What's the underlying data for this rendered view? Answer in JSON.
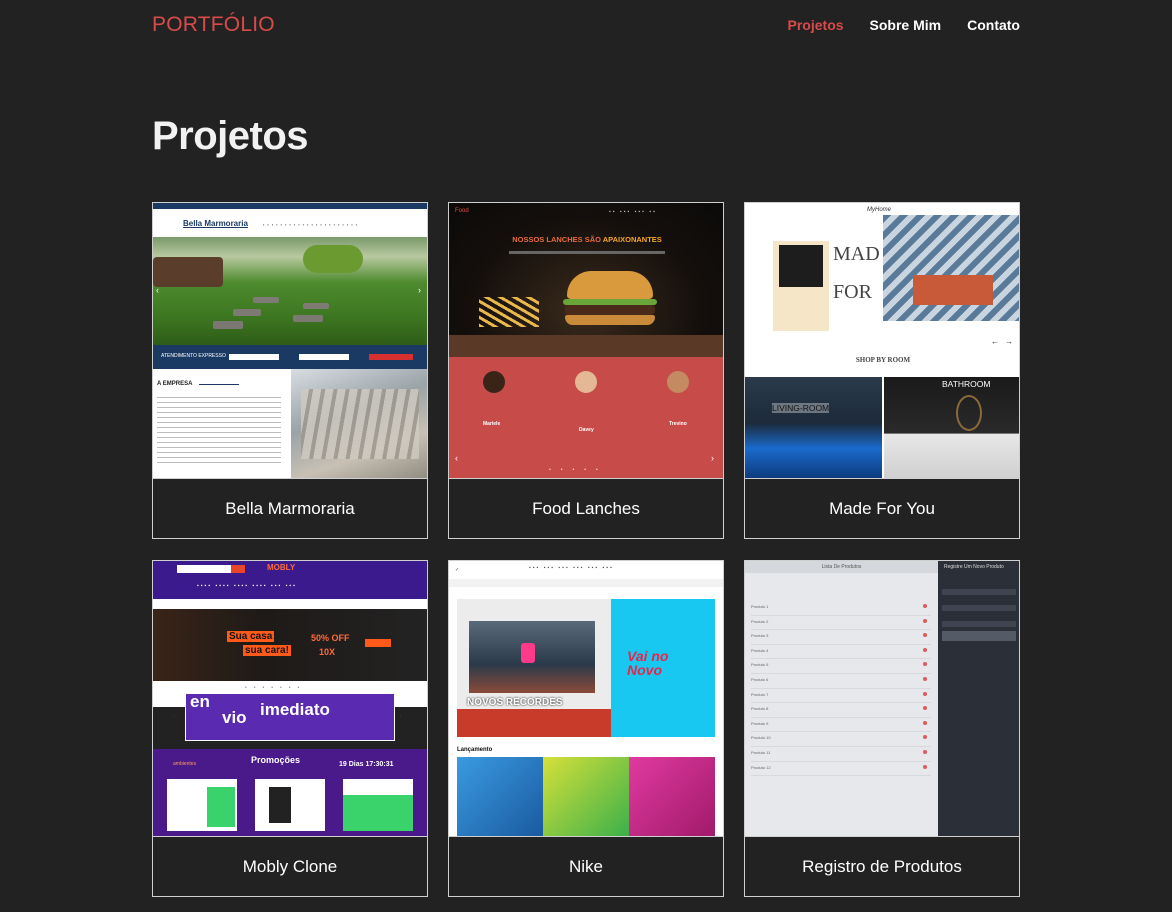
{
  "header": {
    "brand": "PORTFÓLIO",
    "nav": [
      {
        "label": "Projetos",
        "active": true
      },
      {
        "label": "Sobre Mim",
        "active": false
      },
      {
        "label": "Contato",
        "active": false
      }
    ],
    "accent_color": "#d94b4b"
  },
  "page": {
    "title": "Projetos"
  },
  "projects": [
    {
      "name": "Bella Marmoraria",
      "preview": {
        "logo": "Bella Marmoraria",
        "section_title": "A EMPRESA",
        "bar_label": "ATENDIMENTO EXPRESSO"
      }
    },
    {
      "name": "Food Lanches",
      "preview": {
        "logo": "Food",
        "headline_white": "NOSSOS LANCHES SÃO ",
        "headline_accent": "APAIXONANTES",
        "reviewers": [
          "Mariele",
          "Davey",
          "Trevino"
        ]
      }
    },
    {
      "name": "Made For You",
      "preview": {
        "logo": "MyHome",
        "hero_text_1": "MAD",
        "hero_text_2": "FOR",
        "section_label": "SHOP BY ROOM",
        "rooms": [
          "LIVING-ROOM",
          "BATHROOM"
        ]
      }
    },
    {
      "name": "Mobly Clone",
      "preview": {
        "logo": "MOBLY",
        "banner_1": "Sua casa",
        "banner_2": "sua cara!",
        "banner_offer": "50% OFF",
        "banner_installments": "10X",
        "promo_line1": "en",
        "promo_line2": "vio",
        "promo_word": "imediato",
        "section_title": "Promoções",
        "countdown": "19 Dias 17:30:31",
        "ambientes": "ambientes"
      }
    },
    {
      "name": "Nike",
      "preview": {
        "hero_title": "NOVOS RECORDES",
        "side_text": "Vai no Novo",
        "section_label": "Lançamento"
      }
    },
    {
      "name": "Registro de Produtos",
      "preview": {
        "table_title": "Lista De Produtos",
        "side_title": "Registre Um Novo Produto",
        "rows": [
          "Produto 1",
          "Produto 2",
          "Produto 3",
          "Produto 4",
          "Produto 5",
          "Produto 6",
          "Produto 7",
          "Produto 8",
          "Produto 9",
          "Produto 10",
          "Produto 11",
          "Produto 12"
        ]
      }
    }
  ]
}
